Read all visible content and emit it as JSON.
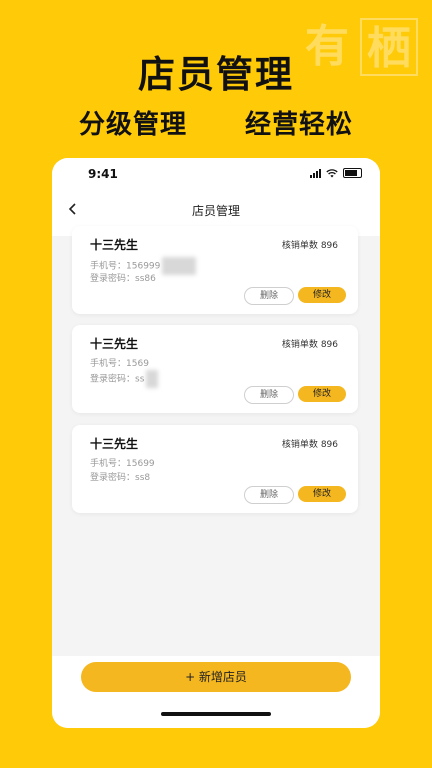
{
  "watermark": [
    "有",
    "栖"
  ],
  "banner": {
    "title": "店员管理",
    "sub_left": "分级管理",
    "sub_right": "经营轻松"
  },
  "status_bar": {
    "time": "9:41"
  },
  "nav": {
    "title": "店员管理",
    "back_icon": "chevron-left-icon"
  },
  "employees": [
    {
      "name": "十三先生",
      "count_label": "核销单数",
      "count_value": "896",
      "phone_label": "手机号：",
      "phone_value": "156999",
      "password_label": "登录密码：",
      "password_value": "ss86",
      "delete_label": "删除",
      "edit_label": "修改"
    },
    {
      "name": "十三先生",
      "count_label": "核销单数",
      "count_value": "896",
      "phone_label": "手机号：",
      "phone_value": "1569",
      "password_label": "登录密码：",
      "password_value": "ss",
      "delete_label": "删除",
      "edit_label": "修改"
    },
    {
      "name": "十三先生",
      "count_label": "核销单数",
      "count_value": "896",
      "phone_label": "手机号：",
      "phone_value": "15699",
      "password_label": "登录密码：",
      "password_value": "ss8",
      "delete_label": "删除",
      "edit_label": "修改"
    }
  ],
  "add_button": {
    "icon": "plus-icon",
    "label": "+ 新增店员"
  },
  "colors": {
    "background": "#FFCA08",
    "accent": "#F5B71F"
  }
}
